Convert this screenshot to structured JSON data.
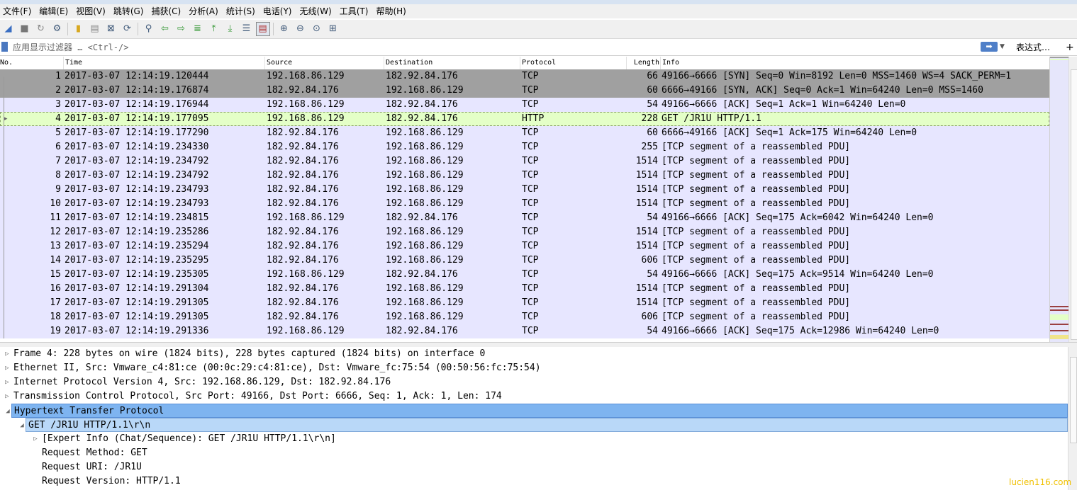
{
  "menu": [
    "文件(F)",
    "编辑(E)",
    "视图(V)",
    "跳转(G)",
    "捕获(C)",
    "分析(A)",
    "统计(S)",
    "电话(Y)",
    "无线(W)",
    "工具(T)",
    "帮助(H)"
  ],
  "toolbar": {
    "icons": [
      "shark-fin-start-icon",
      "stop-capture-icon",
      "restart-capture-icon",
      "capture-options-icon",
      "open-file-icon",
      "save-file-icon",
      "close-file-icon",
      "reload-file-icon",
      "find-packet-icon",
      "go-back-icon",
      "go-forward-icon",
      "go-to-packet-icon",
      "go-first-packet-icon",
      "go-last-packet-icon",
      "auto-scroll-icon",
      "colorize-icon",
      "zoom-in-icon",
      "zoom-out-icon",
      "zoom-normal-icon",
      "resize-columns-icon"
    ]
  },
  "filter": {
    "placeholder": "应用显示过滤器 … <Ctrl-/>",
    "apply_icon": "arrow-right-icon",
    "expression_label": "表达式…",
    "add_label": "+"
  },
  "columns": {
    "no": "No.",
    "time": "Time",
    "source": "Source",
    "destination": "Destination",
    "protocol": "Protocol",
    "length": "Length",
    "info": "Info"
  },
  "packets": [
    {
      "no": "1",
      "time": "2017-03-07 12:14:19.120444",
      "src": "192.168.86.129",
      "dst": "182.92.84.176",
      "proto": "TCP",
      "len": "66",
      "info": "49166→6666 [SYN] Seq=0 Win=8192 Len=0 MSS=1460 WS=4 SACK_PERM=1",
      "kind": "syn"
    },
    {
      "no": "2",
      "time": "2017-03-07 12:14:19.176874",
      "src": "182.92.84.176",
      "dst": "192.168.86.129",
      "proto": "TCP",
      "len": "60",
      "info": "6666→49166 [SYN, ACK] Seq=0 Ack=1 Win=64240 Len=0 MSS=1460",
      "kind": "syn"
    },
    {
      "no": "3",
      "time": "2017-03-07 12:14:19.176944",
      "src": "192.168.86.129",
      "dst": "182.92.84.176",
      "proto": "TCP",
      "len": "54",
      "info": "49166→6666 [ACK] Seq=1 Ack=1 Win=64240 Len=0",
      "kind": "tcp"
    },
    {
      "no": "4",
      "time": "2017-03-07 12:14:19.177095",
      "src": "192.168.86.129",
      "dst": "182.92.84.176",
      "proto": "HTTP",
      "len": "228",
      "info": "GET /JR1U HTTP/1.1",
      "kind": "http"
    },
    {
      "no": "5",
      "time": "2017-03-07 12:14:19.177290",
      "src": "182.92.84.176",
      "dst": "192.168.86.129",
      "proto": "TCP",
      "len": "60",
      "info": "6666→49166 [ACK] Seq=1 Ack=175 Win=64240 Len=0",
      "kind": "tcp"
    },
    {
      "no": "6",
      "time": "2017-03-07 12:14:19.234330",
      "src": "182.92.84.176",
      "dst": "192.168.86.129",
      "proto": "TCP",
      "len": "255",
      "info": "[TCP segment of a reassembled PDU]",
      "kind": "tcp"
    },
    {
      "no": "7",
      "time": "2017-03-07 12:14:19.234792",
      "src": "182.92.84.176",
      "dst": "192.168.86.129",
      "proto": "TCP",
      "len": "1514",
      "info": "[TCP segment of a reassembled PDU]",
      "kind": "tcp"
    },
    {
      "no": "8",
      "time": "2017-03-07 12:14:19.234792",
      "src": "182.92.84.176",
      "dst": "192.168.86.129",
      "proto": "TCP",
      "len": "1514",
      "info": "[TCP segment of a reassembled PDU]",
      "kind": "tcp"
    },
    {
      "no": "9",
      "time": "2017-03-07 12:14:19.234793",
      "src": "182.92.84.176",
      "dst": "192.168.86.129",
      "proto": "TCP",
      "len": "1514",
      "info": "[TCP segment of a reassembled PDU]",
      "kind": "tcp"
    },
    {
      "no": "10",
      "time": "2017-03-07 12:14:19.234793",
      "src": "182.92.84.176",
      "dst": "192.168.86.129",
      "proto": "TCP",
      "len": "1514",
      "info": "[TCP segment of a reassembled PDU]",
      "kind": "tcp"
    },
    {
      "no": "11",
      "time": "2017-03-07 12:14:19.234815",
      "src": "192.168.86.129",
      "dst": "182.92.84.176",
      "proto": "TCP",
      "len": "54",
      "info": "49166→6666 [ACK] Seq=175 Ack=6042 Win=64240 Len=0",
      "kind": "tcp"
    },
    {
      "no": "12",
      "time": "2017-03-07 12:14:19.235286",
      "src": "182.92.84.176",
      "dst": "192.168.86.129",
      "proto": "TCP",
      "len": "1514",
      "info": "[TCP segment of a reassembled PDU]",
      "kind": "tcp"
    },
    {
      "no": "13",
      "time": "2017-03-07 12:14:19.235294",
      "src": "182.92.84.176",
      "dst": "192.168.86.129",
      "proto": "TCP",
      "len": "1514",
      "info": "[TCP segment of a reassembled PDU]",
      "kind": "tcp"
    },
    {
      "no": "14",
      "time": "2017-03-07 12:14:19.235295",
      "src": "182.92.84.176",
      "dst": "192.168.86.129",
      "proto": "TCP",
      "len": "606",
      "info": "[TCP segment of a reassembled PDU]",
      "kind": "tcp"
    },
    {
      "no": "15",
      "time": "2017-03-07 12:14:19.235305",
      "src": "192.168.86.129",
      "dst": "182.92.84.176",
      "proto": "TCP",
      "len": "54",
      "info": "49166→6666 [ACK] Seq=175 Ack=9514 Win=64240 Len=0",
      "kind": "tcp"
    },
    {
      "no": "16",
      "time": "2017-03-07 12:14:19.291304",
      "src": "182.92.84.176",
      "dst": "192.168.86.129",
      "proto": "TCP",
      "len": "1514",
      "info": "[TCP segment of a reassembled PDU]",
      "kind": "tcp"
    },
    {
      "no": "17",
      "time": "2017-03-07 12:14:19.291305",
      "src": "182.92.84.176",
      "dst": "192.168.86.129",
      "proto": "TCP",
      "len": "1514",
      "info": "[TCP segment of a reassembled PDU]",
      "kind": "tcp"
    },
    {
      "no": "18",
      "time": "2017-03-07 12:14:19.291305",
      "src": "182.92.84.176",
      "dst": "192.168.86.129",
      "proto": "TCP",
      "len": "606",
      "info": "[TCP segment of a reassembled PDU]",
      "kind": "tcp"
    },
    {
      "no": "19",
      "time": "2017-03-07 12:14:19.291336",
      "src": "192.168.86.129",
      "dst": "182.92.84.176",
      "proto": "TCP",
      "len": "54",
      "info": "49166→6666 [ACK] Seq=175 Ack=12986 Win=64240 Len=0",
      "kind": "tcp"
    }
  ],
  "selected_packet": "4",
  "details": [
    {
      "text": "Frame 4: 228 bytes on wire (1824 bits), 228 bytes captured (1824 bits) on interface 0",
      "level": 0,
      "state": "collapsed"
    },
    {
      "text": "Ethernet II, Src: Vmware_c4:81:ce (00:0c:29:c4:81:ce), Dst: Vmware_fc:75:54 (00:50:56:fc:75:54)",
      "level": 0,
      "state": "collapsed"
    },
    {
      "text": "Internet Protocol Version 4, Src: 192.168.86.129, Dst: 182.92.84.176",
      "level": 0,
      "state": "collapsed"
    },
    {
      "text": "Transmission Control Protocol, Src Port: 49166, Dst Port: 6666, Seq: 1, Ack: 1, Len: 174",
      "level": 0,
      "state": "collapsed"
    },
    {
      "text": "Hypertext Transfer Protocol",
      "level": 0,
      "state": "expanded",
      "highlight": "sel1"
    },
    {
      "text": "GET /JR1U HTTP/1.1\\r\\n",
      "level": 1,
      "state": "expanded",
      "highlight": "sel2"
    },
    {
      "text": "[Expert Info (Chat/Sequence): GET /JR1U HTTP/1.1\\r\\n]",
      "level": 2,
      "state": "collapsed"
    },
    {
      "text": "Request Method: GET",
      "level": 2,
      "state": "leaf"
    },
    {
      "text": "Request URI: /JR1U",
      "level": 2,
      "state": "leaf"
    },
    {
      "text": "Request Version: HTTP/1.1",
      "level": 2,
      "state": "leaf"
    }
  ],
  "watermark": "lucien116.com",
  "colors": {
    "tcp_row": "#e7e6ff",
    "http_row": "#e4ffc7",
    "syn_row": "#a0a0a0",
    "detail_selected": "#7eb4f0"
  }
}
